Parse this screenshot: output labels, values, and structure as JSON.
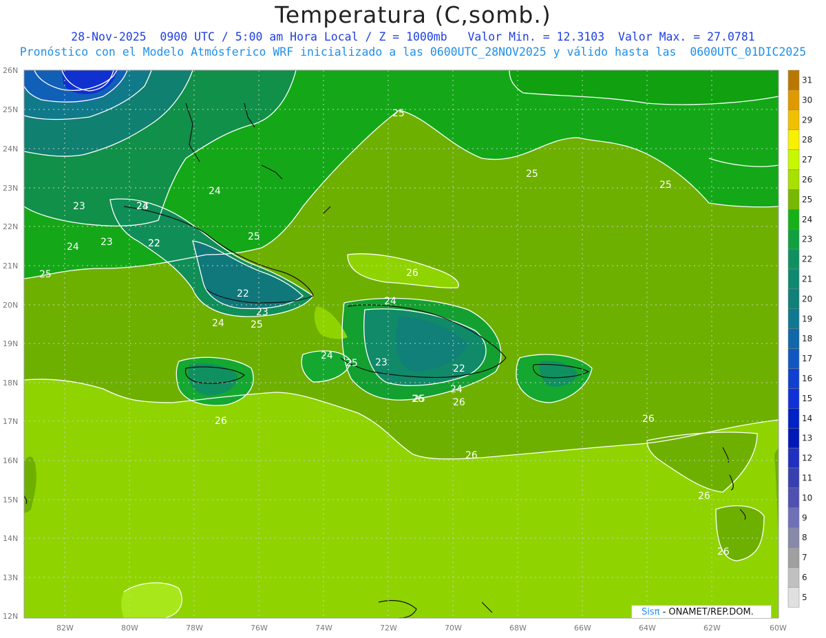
{
  "title": "Temperatura (C,somb.)",
  "subtitle_line1": "28-Nov-2025  0900 UTC / 5:00 am Hora Local / Z = 1000mb   Valor Min. = 12.3103  Valor Max. = 27.0781",
  "subtitle_line2": "Pronóstico con el Modelo Atmósferico WRF inicializado a las 0600UTC_28NOV2025 y válido hasta las  0600UTC_01DIC2025",
  "lat_labels": [
    "26N",
    "25N",
    "24N",
    "23N",
    "22N",
    "21N",
    "20N",
    "19N",
    "18N",
    "17N",
    "16N",
    "15N",
    "14N",
    "13N",
    "12N"
  ],
  "lon_labels": [
    "82W",
    "80W",
    "78W",
    "76W",
    "74W",
    "72W",
    "70W",
    "68W",
    "66W",
    "64W",
    "62W",
    "60W"
  ],
  "colorbar": {
    "values": [
      "31",
      "30",
      "29",
      "28",
      "27",
      "26",
      "25",
      "24",
      "23",
      "22",
      "21",
      "20",
      "19",
      "18",
      "17",
      "16",
      "15",
      "14",
      "13",
      "12",
      "11",
      "10",
      "9",
      "8",
      "7",
      "6",
      "5"
    ],
    "colors": [
      "#b87800",
      "#e09a00",
      "#f0c000",
      "#f8f000",
      "#c8f800",
      "#a8e000",
      "#78b800",
      "#18b018",
      "#10a040",
      "#109060",
      "#108870",
      "#108078",
      "#107890",
      "#1068a8",
      "#1058c0",
      "#1040d0",
      "#1030d8",
      "#0020c8",
      "#0018b8",
      "#2030c0",
      "#3840b0",
      "#5050b0",
      "#7070b8",
      "#8888a8",
      "#a0a0a0",
      "#c0c0c0",
      "#e0e0e0"
    ]
  },
  "contour_labels": [
    "25",
    "25",
    "24",
    "23",
    "24",
    "22",
    "23",
    "25",
    "24",
    "25",
    "26",
    "25",
    "24",
    "22",
    "23",
    "24",
    "25",
    "26",
    "26",
    "26",
    "26",
    "26",
    "26",
    "26",
    "24",
    "25",
    "23",
    "22",
    "24",
    "25",
    "23",
    "22"
  ],
  "credit": {
    "brand": "Sisπ",
    "text": " - ONAMET/REP.DOM."
  }
}
